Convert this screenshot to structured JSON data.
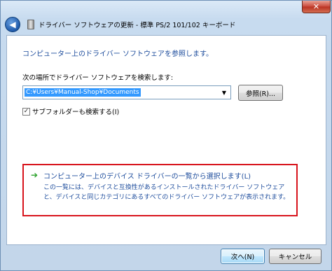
{
  "window": {
    "title": "ドライバー ソフトウェアの更新 - 標準 PS/2 101/102 キーボード",
    "close_glyph": "✕"
  },
  "header": {
    "back_glyph": "◀"
  },
  "main": {
    "heading": "コンピューター上のドライバー ソフトウェアを参照します。",
    "search_label": "次の場所でドライバー ソフトウェアを検索します:",
    "path_value": "C:¥Users¥Manual-Shop¥Documents",
    "combo_arrow": "▼",
    "browse_label": "参照(R)...",
    "subfolder_label": "サブフォルダーも検索する(I)",
    "subfolder_checked": true,
    "check_glyph": "✓"
  },
  "pick": {
    "arrow_glyph": "➔",
    "title": "コンピューター上のデバイス ドライバーの一覧から選択します(L)",
    "description": "この一覧には、デバイスと互換性があるインストールされたドライバー ソフトウェアと、デバイスと同じカテゴリにあるすべてのドライバー ソフトウェアが表示されます。",
    "highlight_color": "#d8141c"
  },
  "footer": {
    "next_label": "次へ(N)",
    "cancel_label": "キャンセル"
  }
}
